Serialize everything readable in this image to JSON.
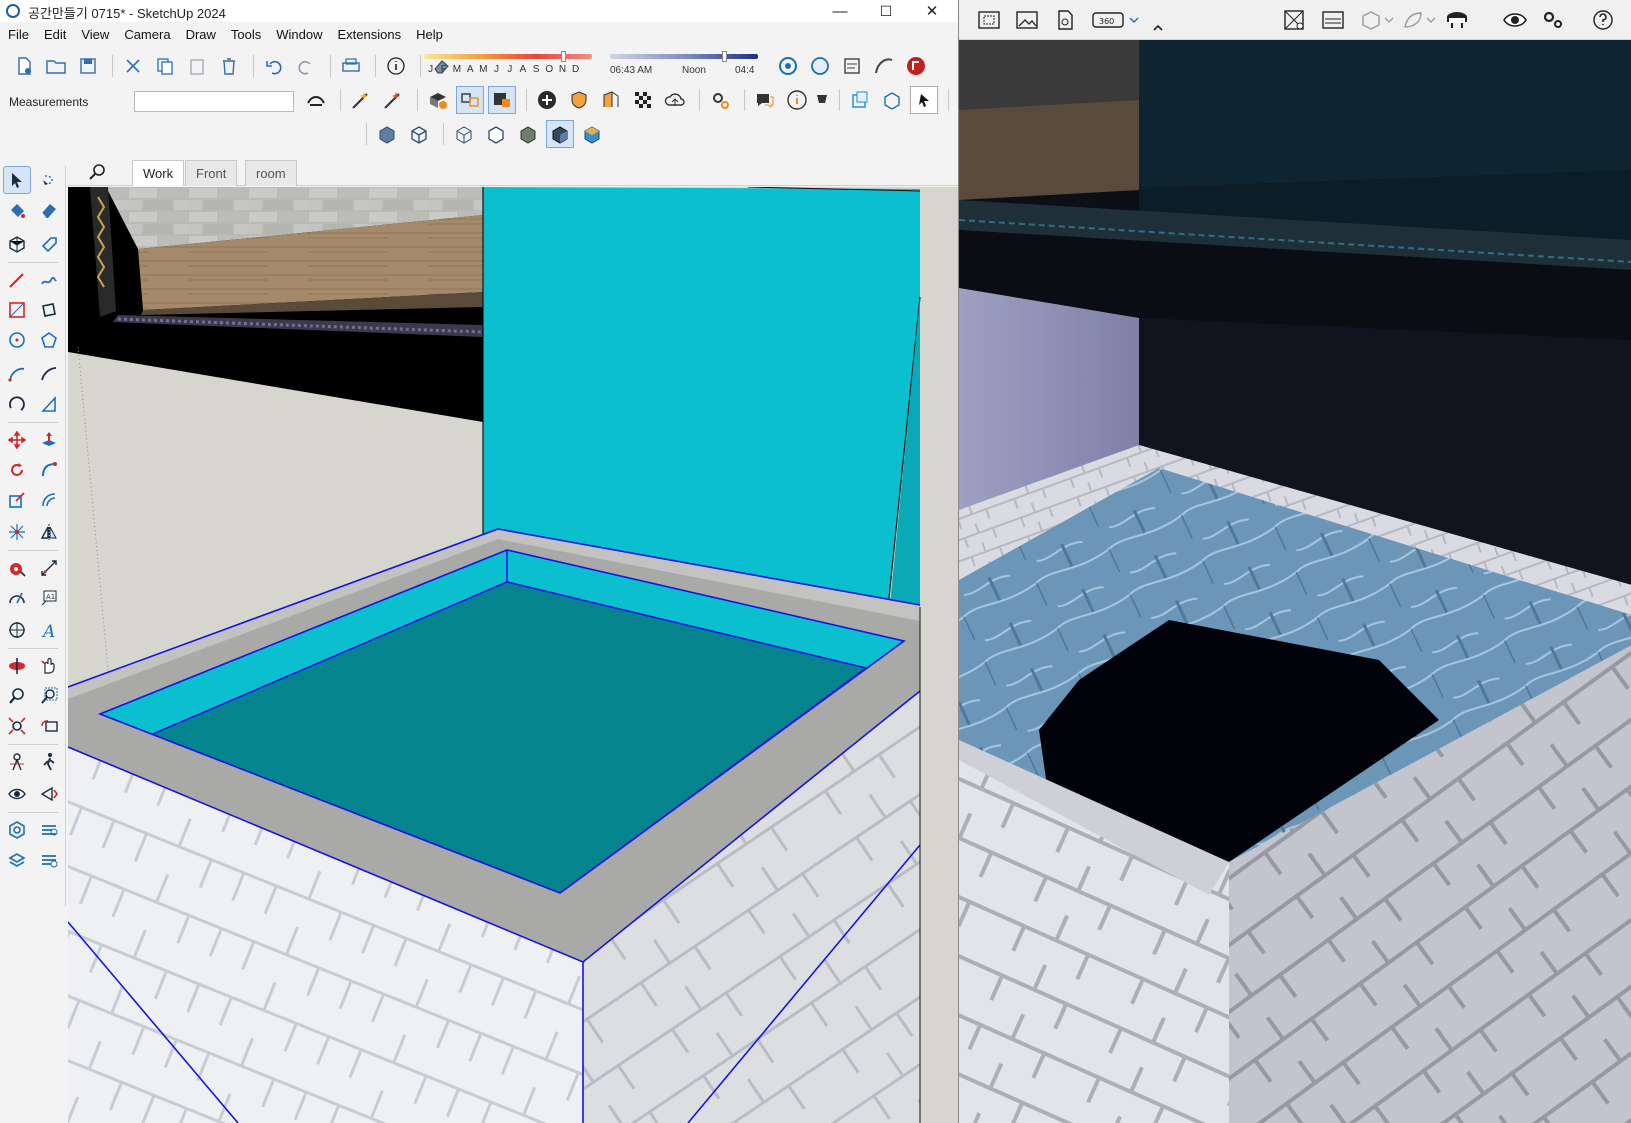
{
  "window": {
    "title": "공간만들기 0715* - SketchUp 2024",
    "minimize": "—",
    "maximize": "☐",
    "close": "✕"
  },
  "menu": [
    "File",
    "Edit",
    "View",
    "Camera",
    "Draw",
    "Tools",
    "Window",
    "Extensions",
    "Help"
  ],
  "shadow": {
    "months": [
      "J",
      "F",
      "M",
      "A",
      "M",
      "J",
      "J",
      "A",
      "S",
      "O",
      "N",
      "D"
    ],
    "time_start": "06:43 AM",
    "time_mid": "Noon",
    "time_end": "04:4"
  },
  "measurements": {
    "label": "Measurements",
    "value": ""
  },
  "scene_tabs": [
    "Work",
    "Front",
    "room"
  ],
  "active_scene": "Work",
  "icons": {
    "search": "search-icon"
  },
  "colors": {
    "water": "#0bbfcf",
    "water_dark": "#06848e",
    "selection_edge": "#1414e6",
    "ground": "#d6d6ce",
    "brick": "#e9ebef",
    "render_bg": "#0c1016"
  }
}
